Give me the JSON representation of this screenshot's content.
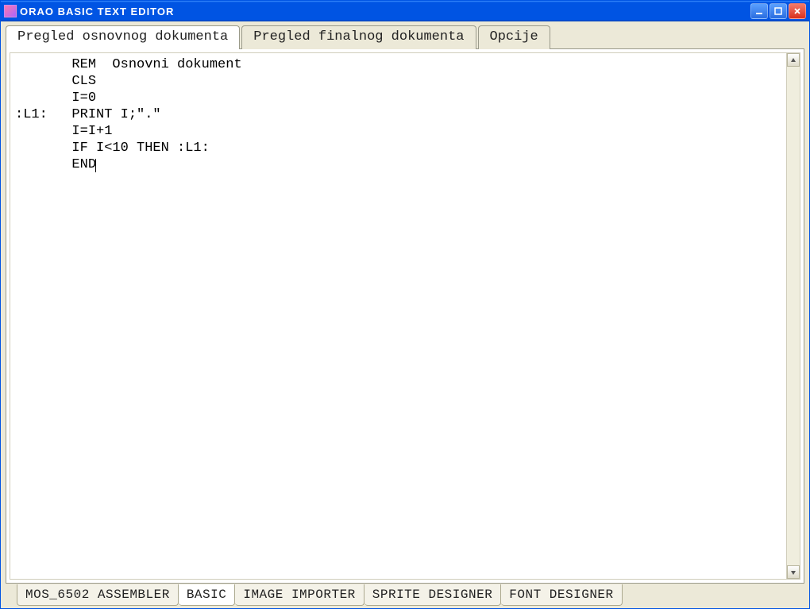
{
  "window": {
    "title": "ORAO  BASIC  TEXT  EDITOR"
  },
  "top_tabs": [
    {
      "label": "Pregled osnovnog dokumenta",
      "active": true
    },
    {
      "label": "Pregled finalnog dokumenta",
      "active": false
    },
    {
      "label": "Opcije",
      "active": false
    }
  ],
  "editor_code": "       REM  Osnovni dokument\n       CLS\n       I=0\n:L1:   PRINT I;\".\"\n       I=I+1\n       IF I<10 THEN :L1:\n       END",
  "bottom_tabs": [
    {
      "label": "MOS_6502 ASSEMBLER",
      "active": false
    },
    {
      "label": "BASIC",
      "active": true
    },
    {
      "label": "IMAGE IMPORTER",
      "active": false
    },
    {
      "label": "SPRITE DESIGNER",
      "active": false
    },
    {
      "label": "FONT DESIGNER",
      "active": false
    }
  ]
}
